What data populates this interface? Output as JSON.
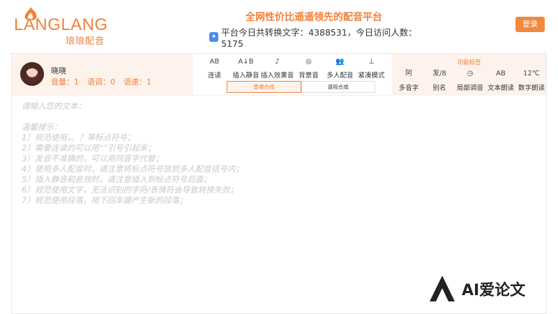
{
  "brand": {
    "name": "LANGLANG",
    "subtitle": "琅琅配音",
    "accent": "#f0813a"
  },
  "header": {
    "title": "全网性价比遥遥领先的配音平台",
    "stats": "平台今日共转换文字：4388531，今日访问人数：5175",
    "login_label": "登录"
  },
  "user": {
    "name": "晓晓",
    "volume": "音量：1",
    "pitch": "语调：0",
    "speed": "语速：1"
  },
  "tools": [
    {
      "icon": "AB",
      "label": "连读"
    },
    {
      "icon": "A↓B",
      "label": "插入静音"
    },
    {
      "icon": "♪",
      "label": "插入效果音"
    },
    {
      "icon": "◎",
      "label": "背景音"
    },
    {
      "icon": "👥",
      "label": "多人配音"
    },
    {
      "icon": "⊥",
      "label": "紧凑模式"
    }
  ],
  "modes": {
    "active": "普通合成",
    "other": "逐段合成"
  },
  "functions": {
    "title": "功能标签",
    "items": [
      {
        "icon": "阿",
        "label": "多音字"
      },
      {
        "icon": "发/8",
        "label": "别名"
      },
      {
        "icon": "◷",
        "label": "局部调音"
      },
      {
        "icon": "AB",
        "label": "文本朗读"
      },
      {
        "icon": "12℃",
        "label": "数字朗读"
      }
    ]
  },
  "editor": {
    "lines": [
      "请输入您的文本：",
      "",
      "温馨提示：",
      "1）规范使用，。？等标点符号；",
      "2）需要连读的可以用“”引号引起来；",
      "3）发音不准确的，可以用同音字代替；",
      "4）使用多人配音时，请注意将标点符号放到多人配音括号内；",
      "5）插入静音和音效时，请注意插入到标点符号后面；",
      "6）规范使用文字，无法识别的字符/表情符会导致转换失败；",
      "7）规范使用段落，按下回车键产生新的段落；"
    ]
  },
  "watermark": {
    "text": "AI爱论文"
  }
}
